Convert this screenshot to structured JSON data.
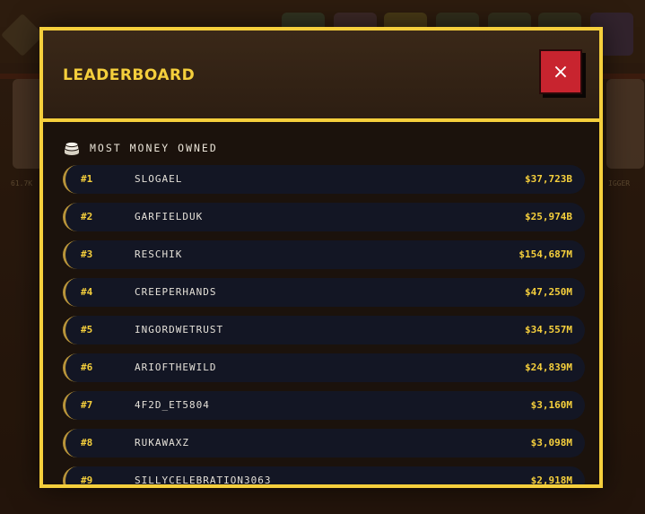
{
  "modal": {
    "title": "LEADERBOARD",
    "close_label": "×"
  },
  "section": {
    "label": "MOST MONEY OWNED",
    "icon": "coins-icon"
  },
  "background": {
    "left_card_label": "61.7K",
    "right_card_label": "IGGER"
  },
  "leaderboard": [
    {
      "rank": "#1",
      "name": "SLOGAEL",
      "amount": "$37,723B"
    },
    {
      "rank": "#2",
      "name": "GARFIELDUK",
      "amount": "$25,974B"
    },
    {
      "rank": "#3",
      "name": "RESCHIK",
      "amount": "$154,687M"
    },
    {
      "rank": "#4",
      "name": "CREEPERHANDS",
      "amount": "$47,250M"
    },
    {
      "rank": "#5",
      "name": "INGORDWETRUST",
      "amount": "$34,557M"
    },
    {
      "rank": "#6",
      "name": "ARIOFTHEWILD",
      "amount": "$24,839M"
    },
    {
      "rank": "#7",
      "name": "4F2D_ET5804",
      "amount": "$3,160M"
    },
    {
      "rank": "#8",
      "name": "RUKAWAXZ",
      "amount": "$3,098M"
    },
    {
      "rank": "#9",
      "name": "SILLYCELEBRATION3063",
      "amount": "$2,918M"
    }
  ],
  "colors": {
    "accent": "#f5cf3c",
    "close": "#c8242f",
    "row_bg": "#131624"
  }
}
